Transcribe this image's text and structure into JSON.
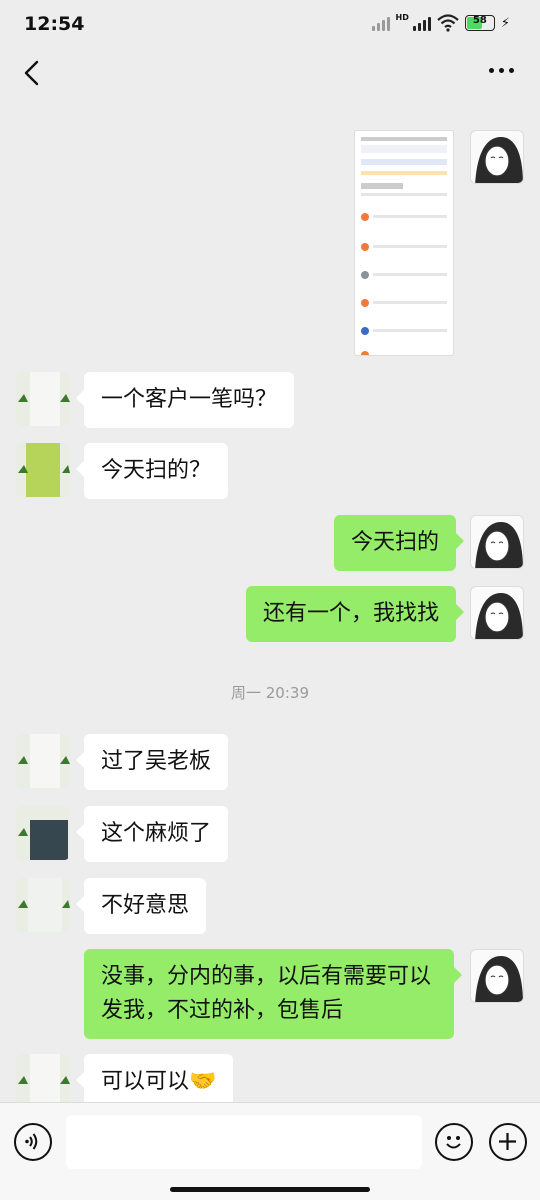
{
  "status_bar": {
    "time": "12:54",
    "battery": "58",
    "hd_label": "HD"
  },
  "nav": {
    "back_icon": "chevron-left-icon",
    "more_icon": "more-horizontal-icon"
  },
  "messages": [
    {
      "side": "out",
      "type": "image"
    },
    {
      "side": "in",
      "text": "一个客户一笔吗？"
    },
    {
      "side": "in",
      "text": "今天扫的？"
    },
    {
      "side": "out",
      "text": "今天扫的"
    },
    {
      "side": "out",
      "text": "还有一个，我找找"
    },
    {
      "type": "time",
      "text": "周一 20:39"
    },
    {
      "side": "in",
      "text": "过了吴老板"
    },
    {
      "side": "in",
      "text": "这个麻烦了"
    },
    {
      "side": "in",
      "text": "不好意思"
    },
    {
      "side": "out",
      "text_line1": "没事，分内的事，以后有需要可以",
      "text_line2": "发我，不过的补，包售后"
    },
    {
      "side": "in",
      "text": "可以可以🤝"
    }
  ],
  "input_bar": {
    "placeholder": "",
    "voice_icon": "voice-icon",
    "emoji_icon": "emoji-icon",
    "plus_icon": "plus-icon"
  },
  "colors": {
    "out_bubble": "#95ec69",
    "in_bubble": "#ffffff",
    "background": "#ededed"
  }
}
